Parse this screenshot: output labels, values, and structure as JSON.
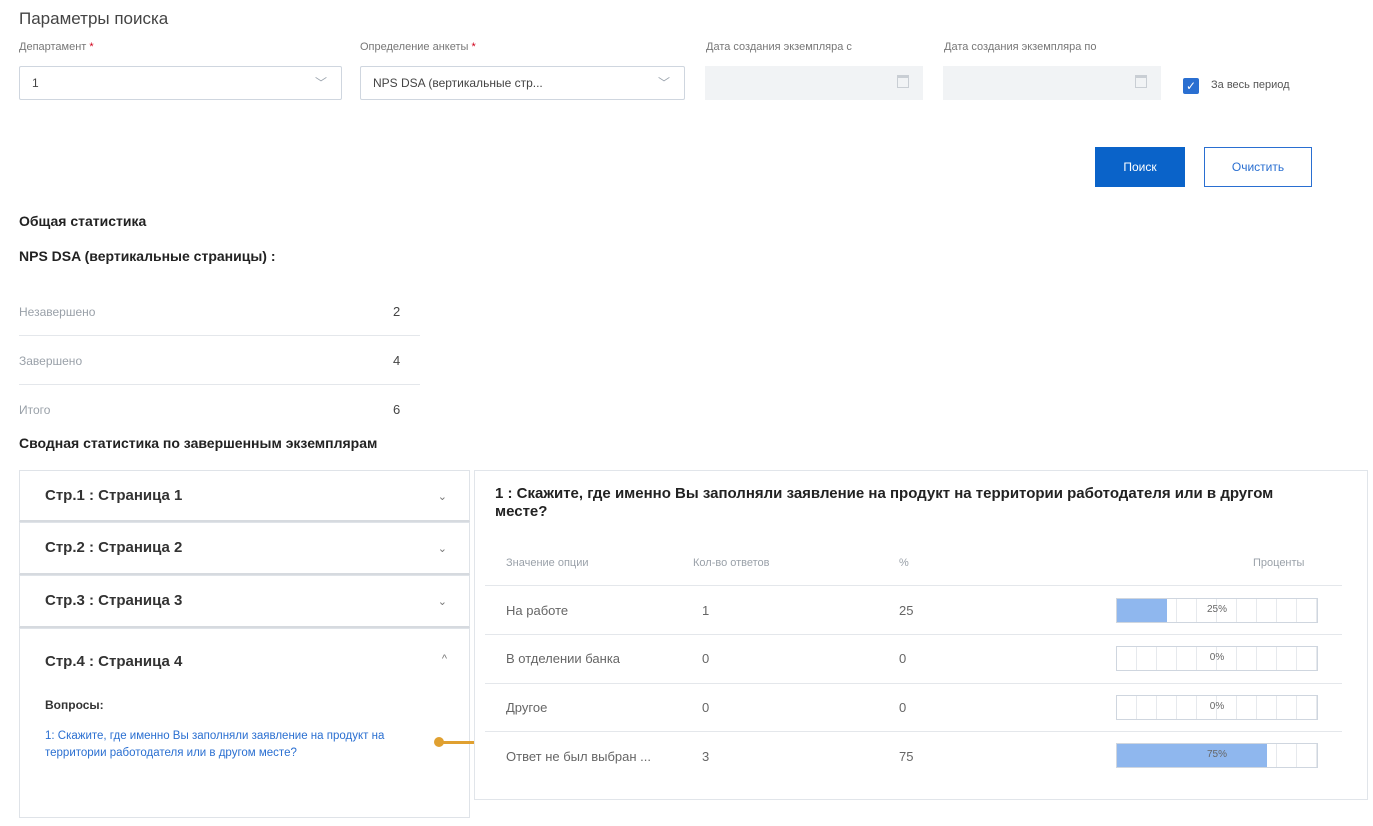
{
  "search": {
    "title": "Параметры поиска",
    "department": {
      "label": "Департамент",
      "required_mark": "*",
      "value": "1"
    },
    "questionnaire": {
      "label": "Определение анкеты",
      "required_mark": "*",
      "value": "NPS DSA (вертикальные стр..."
    },
    "date_from": {
      "label": "Дата создания экземпляра с",
      "value": ""
    },
    "date_to": {
      "label": "Дата создания экземпляра по",
      "value": ""
    },
    "whole_period": {
      "label": "За весь период",
      "checked": true
    },
    "search_button": "Поиск",
    "clear_button": "Очистить"
  },
  "general": {
    "title": "Общая статистика",
    "subtitle": "NPS DSA (вертикальные страницы) :",
    "rows": [
      {
        "label": "Незавершено",
        "value": "2"
      },
      {
        "label": "Завершено",
        "value": "4"
      },
      {
        "label": "Итого",
        "value": "6"
      }
    ]
  },
  "summary": {
    "title": "Сводная статистика по завершенным экземплярам",
    "pages": [
      {
        "label": "Стр.1 : Страница 1",
        "expanded": false
      },
      {
        "label": "Стр.2 : Страница 2",
        "expanded": false
      },
      {
        "label": "Стр.3 : Страница 3",
        "expanded": false
      },
      {
        "label": "Стр.4 : Страница 4",
        "expanded": true
      }
    ],
    "questions_label": "Вопросы:",
    "question_link": "1: Скажите, где именно Вы заполняли заявление на продукт на территории работодателя или в другом месте?"
  },
  "question": {
    "title": "1 : Скажите, где именно Вы заполняли заявление на продукт на территории работодателя или в другом месте?",
    "headers": {
      "option": "Значение опции",
      "count": "Кол-во ответов",
      "pct": "%",
      "bar": "Проценты"
    },
    "rows": [
      {
        "option": "На работе",
        "count": "1",
        "pct": "25",
        "bar_label": "25%",
        "fraction": 0.25
      },
      {
        "option": "В отделении банка",
        "count": "0",
        "pct": "0",
        "bar_label": "0%",
        "fraction": 0
      },
      {
        "option": "Другое",
        "count": "0",
        "pct": "0",
        "bar_label": "0%",
        "fraction": 0
      },
      {
        "option": "Ответ не был выбран ...",
        "count": "3",
        "pct": "75",
        "bar_label": "75%",
        "fraction": 0.75
      }
    ]
  },
  "icons": {
    "chevron": "chevron-down-icon",
    "calendar": "calendar-icon",
    "check": "check-icon"
  },
  "colors": {
    "primary": "#0a63c9",
    "bar_fill": "#8fb7ee",
    "arrow": "#e0a030",
    "required": "#d0021b"
  }
}
